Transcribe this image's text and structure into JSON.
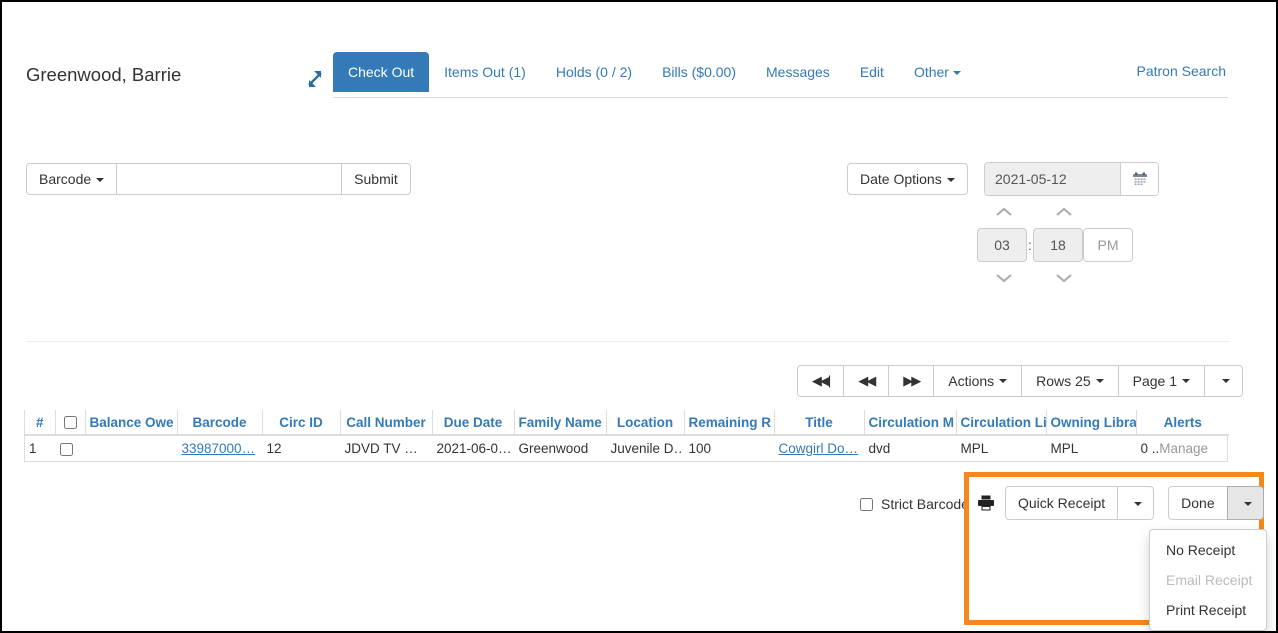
{
  "header": {
    "patron_name": "Greenwood, Barrie",
    "expand_icon": "expand-arrows-icon",
    "patron_search": "Patron Search",
    "tabs": [
      {
        "label": "Check Out",
        "active": true
      },
      {
        "label": "Items Out (1)",
        "active": false
      },
      {
        "label": "Holds (0 / 2)",
        "active": false
      },
      {
        "label": "Bills ($0.00)",
        "active": false
      },
      {
        "label": "Messages",
        "active": false
      },
      {
        "label": "Edit",
        "active": false
      },
      {
        "label": "Other",
        "active": false,
        "caret": true
      }
    ]
  },
  "checkout_form": {
    "type_button": "Barcode",
    "barcode_value": "",
    "barcode_placeholder": "",
    "submit_label": "Submit"
  },
  "date_panel": {
    "date_options_label": "Date Options",
    "date_value": "2021-05-12",
    "calendar_icon": "calendar-icon",
    "hour": "03",
    "minute": "18",
    "meridiem": "PM",
    "colon": ":"
  },
  "grid_toolbar": {
    "first_page_icon": "first-page-icon",
    "prev_page_icon": "previous-page-icon",
    "next_page_icon": "next-page-icon",
    "actions_label": "Actions",
    "rows_label": "Rows 25",
    "page_label": "Page 1",
    "more_icon": "chevron-down-icon"
  },
  "grid": {
    "columns": [
      "#",
      "",
      "Balance Owe",
      "Barcode",
      "Circ ID",
      "Call Number",
      "Due Date",
      "Family Name",
      "Location",
      "Remaining R",
      "Title",
      "Circulation M",
      "Circulation Li",
      "Owning Libra",
      "Alerts"
    ],
    "rows": [
      {
        "num": "1",
        "balance_owed": "",
        "barcode": "33987000…",
        "circ_id": "12",
        "call_number": "JDVD TV …",
        "due_date": "2021-06-0…",
        "family_name": "Greenwood",
        "location": "Juvenile D…",
        "remaining_renewals": "100",
        "title": "Cowgirl Do…",
        "circulation_modifier": "dvd",
        "circulation_library": "MPL",
        "owning_library": "MPL",
        "alerts_count": "0 ..",
        "alerts_manage": "Manage"
      }
    ]
  },
  "footer": {
    "strict_barcode_label": "Strict Barcode",
    "printer_icon": "printer-icon",
    "quick_receipt_label": "Quick Receipt",
    "quick_receipt_caret": "chevron-down-icon",
    "done_label": "Done",
    "done_caret": "chevron-down-icon",
    "receipt_menu": [
      {
        "label": "No Receipt",
        "disabled": false
      },
      {
        "label": "Email Receipt",
        "disabled": true
      },
      {
        "label": "Print Receipt",
        "disabled": false
      }
    ]
  },
  "colors": {
    "primary": "#337ab7",
    "link": "#337ab7",
    "highlight": "#f6861f",
    "border": "#cccccc",
    "muted": "#999999"
  }
}
